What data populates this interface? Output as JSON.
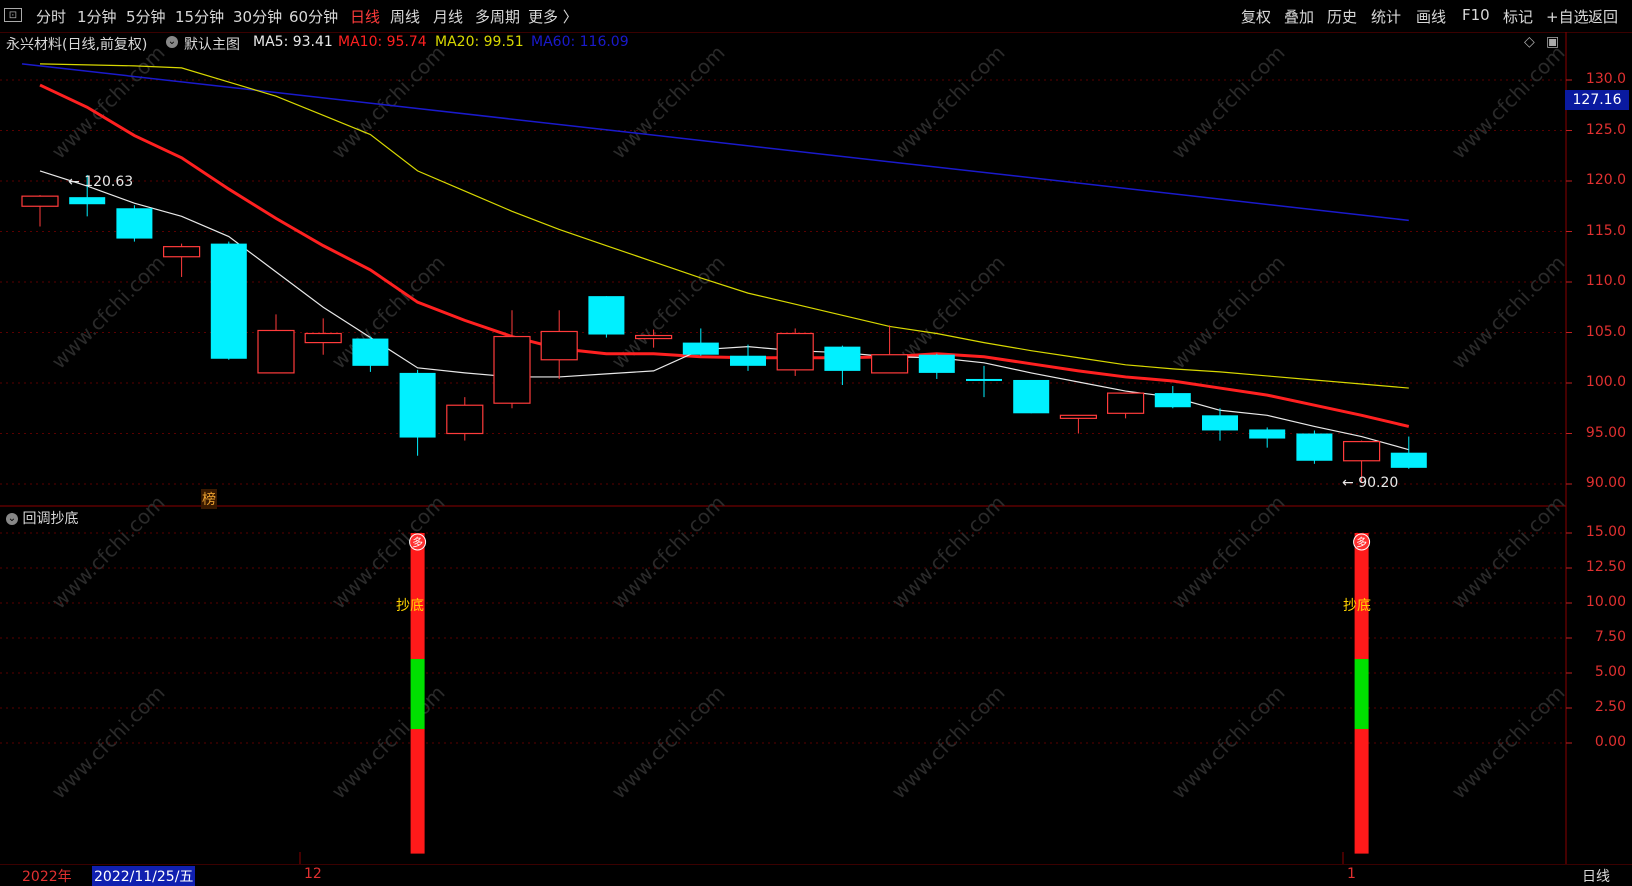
{
  "toolbar": {
    "left": [
      "分时",
      "1分钟",
      "5分钟",
      "15分钟",
      "30分钟",
      "60分钟",
      "日线",
      "周线",
      "月线",
      "多周期",
      "更多 〉"
    ],
    "active": "日线",
    "right": [
      "复权",
      "叠加",
      "历史",
      "统计",
      "画线",
      "F10",
      "标记",
      "+自选",
      "返回"
    ]
  },
  "info": {
    "stock": "永兴材料(日线,前复权)",
    "theme": "默认主图",
    "ma5": "MA5: 93.41",
    "ma10": "MA10: 95.74",
    "ma20": "MA20: 99.51",
    "ma60": "MA60: 116.09"
  },
  "colors": {
    "up": "#ff3b3b",
    "down": "#00f0ff",
    "ma5": "#e8e8e8",
    "ma10": "#ff2020",
    "ma20": "#d8d800",
    "ma60": "#1a1acc",
    "grid": "#5a0000"
  },
  "price_axis": [
    "130.0",
    "125.0",
    "120.0",
    "115.0",
    "110.0",
    "105.0",
    "100.0",
    "95.00",
    "90.00"
  ],
  "current_price": "127.16",
  "high_label": "120.63",
  "low_label": "90.20",
  "rank_label": "榜",
  "indicator": {
    "name": "回调抄底",
    "axis": [
      "15.00",
      "12.50",
      "10.00",
      "7.50",
      "5.00",
      "2.50",
      "0.00"
    ],
    "signal_badge": "多",
    "signal_text": "抄底"
  },
  "bottom": {
    "year": "2022年",
    "date": "2022/11/25/五",
    "month1": "12",
    "month2": "1",
    "period": "日线"
  },
  "watermark": "www.cfchi.com",
  "chart_data": {
    "type": "candlestick",
    "ylim": [
      89,
      132
    ],
    "candles": [
      {
        "o": 117.5,
        "h": 118.6,
        "l": 115.5,
        "c": 118.5
      },
      {
        "o": 118.4,
        "h": 120.6,
        "l": 116.5,
        "c": 117.7
      },
      {
        "o": 117.3,
        "h": 117.6,
        "l": 114.0,
        "c": 114.3
      },
      {
        "o": 112.5,
        "h": 113.8,
        "l": 110.5,
        "c": 113.5
      },
      {
        "o": 113.8,
        "h": 114.0,
        "l": 102.3,
        "c": 102.4
      },
      {
        "o": 101.0,
        "h": 106.8,
        "l": 101.0,
        "c": 105.2
      },
      {
        "o": 104.0,
        "h": 106.4,
        "l": 102.8,
        "c": 104.9
      },
      {
        "o": 104.4,
        "h": 104.6,
        "l": 101.1,
        "c": 101.7
      },
      {
        "o": 101.0,
        "h": 101.3,
        "l": 92.8,
        "c": 94.6
      },
      {
        "o": 95.0,
        "h": 98.6,
        "l": 94.3,
        "c": 97.8
      },
      {
        "o": 98.0,
        "h": 107.2,
        "l": 97.5,
        "c": 104.6
      },
      {
        "o": 102.3,
        "h": 107.2,
        "l": 100.4,
        "c": 105.1
      },
      {
        "o": 108.6,
        "h": 108.6,
        "l": 104.5,
        "c": 104.8
      },
      {
        "o": 104.4,
        "h": 105.3,
        "l": 103.5,
        "c": 104.7
      },
      {
        "o": 104.0,
        "h": 105.4,
        "l": 102.7,
        "c": 102.8
      },
      {
        "o": 102.7,
        "h": 103.8,
        "l": 101.2,
        "c": 101.7
      },
      {
        "o": 101.3,
        "h": 105.4,
        "l": 100.7,
        "c": 104.9
      },
      {
        "o": 103.6,
        "h": 103.7,
        "l": 99.8,
        "c": 101.2
      },
      {
        "o": 101.0,
        "h": 105.7,
        "l": 101.0,
        "c": 102.8
      },
      {
        "o": 102.8,
        "h": 102.9,
        "l": 100.4,
        "c": 101.0
      },
      {
        "o": 100.4,
        "h": 101.7,
        "l": 98.6,
        "c": 100.2
      },
      {
        "o": 100.3,
        "h": 100.3,
        "l": 97.0,
        "c": 97.0
      },
      {
        "o": 96.5,
        "h": 96.8,
        "l": 95.0,
        "c": 96.8
      },
      {
        "o": 97.0,
        "h": 99.0,
        "l": 96.5,
        "c": 99.0
      },
      {
        "o": 99.0,
        "h": 99.7,
        "l": 97.5,
        "c": 97.6
      },
      {
        "o": 96.8,
        "h": 97.5,
        "l": 94.3,
        "c": 95.3
      },
      {
        "o": 95.4,
        "h": 95.6,
        "l": 93.6,
        "c": 94.5
      },
      {
        "o": 95.0,
        "h": 95.3,
        "l": 92.0,
        "c": 92.3
      },
      {
        "o": 92.3,
        "h": 94.3,
        "l": 90.2,
        "c": 94.2
      },
      {
        "o": 93.1,
        "h": 94.7,
        "l": 91.5,
        "c": 91.6
      }
    ],
    "ma5": [
      121.0,
      119.5,
      117.8,
      116.5,
      114.5,
      111.0,
      107.5,
      104.5,
      101.5,
      101.0,
      100.6,
      100.6,
      100.9,
      101.2,
      103.3,
      103.6,
      103.2,
      103.0,
      102.6,
      102.5,
      102.0,
      101.0,
      100.1,
      99.2,
      98.6,
      97.3,
      96.8,
      95.7,
      94.7,
      93.4
    ],
    "ma10": [
      129.5,
      127.3,
      124.5,
      122.3,
      119.2,
      116.3,
      113.6,
      111.2,
      108.0,
      106.2,
      104.6,
      103.4,
      102.9,
      102.9,
      102.6,
      102.5,
      102.5,
      102.5,
      102.6,
      102.9,
      102.6,
      101.9,
      101.2,
      100.6,
      100.2,
      99.5,
      98.8,
      97.8,
      96.8,
      95.7
    ],
    "ma20": [
      131.6,
      131.5,
      131.4,
      131.2,
      129.8,
      128.4,
      126.5,
      124.6,
      121.0,
      119.0,
      117.0,
      115.2,
      113.6,
      112.0,
      110.4,
      108.9,
      107.8,
      106.7,
      105.6,
      104.9,
      104.0,
      103.2,
      102.5,
      101.8,
      101.4,
      101.1,
      100.7,
      100.3,
      99.9,
      99.5
    ],
    "ma60": [
      131.6,
      116.1
    ],
    "indicator_series": [
      {
        "name": "signal",
        "values": [
          {
            "bar": 8,
            "top": 15,
            "mid_high": 6.0,
            "mid_low": 1.0,
            "bottom": -7.9
          },
          {
            "bar": 28,
            "top": 15,
            "mid_high": 6.0,
            "mid_low": 1.0,
            "bottom": -7.9
          }
        ]
      }
    ]
  }
}
